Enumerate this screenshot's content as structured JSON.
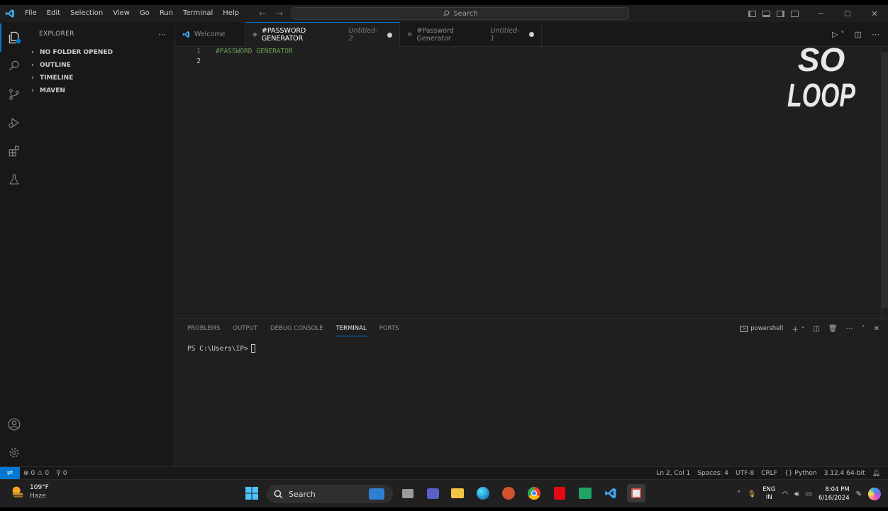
{
  "menu": [
    "File",
    "Edit",
    "Selection",
    "View",
    "Go",
    "Run",
    "Terminal",
    "Help"
  ],
  "command_center": {
    "label": "Search"
  },
  "sidebar": {
    "title": "EXPLORER",
    "sections": [
      "NO FOLDER OPENED",
      "OUTLINE",
      "TIMELINE",
      "MAVEN"
    ]
  },
  "tabs": [
    {
      "label": "Welcome",
      "sub": ""
    },
    {
      "label": "#PASSWORD GENERATOR",
      "sub": "Untitled-2"
    },
    {
      "label": "#Password Generator",
      "sub": "Untitled-1"
    }
  ],
  "editor": {
    "lines": [
      {
        "num": "1",
        "text": "#PASSWORD GENERATOR"
      },
      {
        "num": "2",
        "text": ""
      }
    ]
  },
  "watermark": {
    "line1": "SO",
    "line2": "LOOP"
  },
  "panel": {
    "tabs": [
      "PROBLEMS",
      "OUTPUT",
      "DEBUG CONSOLE",
      "TERMINAL",
      "PORTS"
    ],
    "shell": "powershell",
    "prompt": "PS C:\\Users\\IP>"
  },
  "statusbar": {
    "errors": "0",
    "warnings": "0",
    "ports": "0",
    "position": "Ln 2, Col 1",
    "spaces": "Spaces: 4",
    "encoding": "UTF-8",
    "eol": "CRLF",
    "language": "Python",
    "interpreter": "3.12.4 64-bit"
  },
  "taskbar": {
    "weather_temp": "109°F",
    "weather_desc": "Haze",
    "search": "Search",
    "lang_top": "ENG",
    "lang_bottom": "IN",
    "time": "8:04 PM",
    "date": "6/16/2024"
  },
  "colors": {
    "accent": "#0078d4",
    "comment": "#6a9955",
    "background": "#1f1f1f"
  }
}
